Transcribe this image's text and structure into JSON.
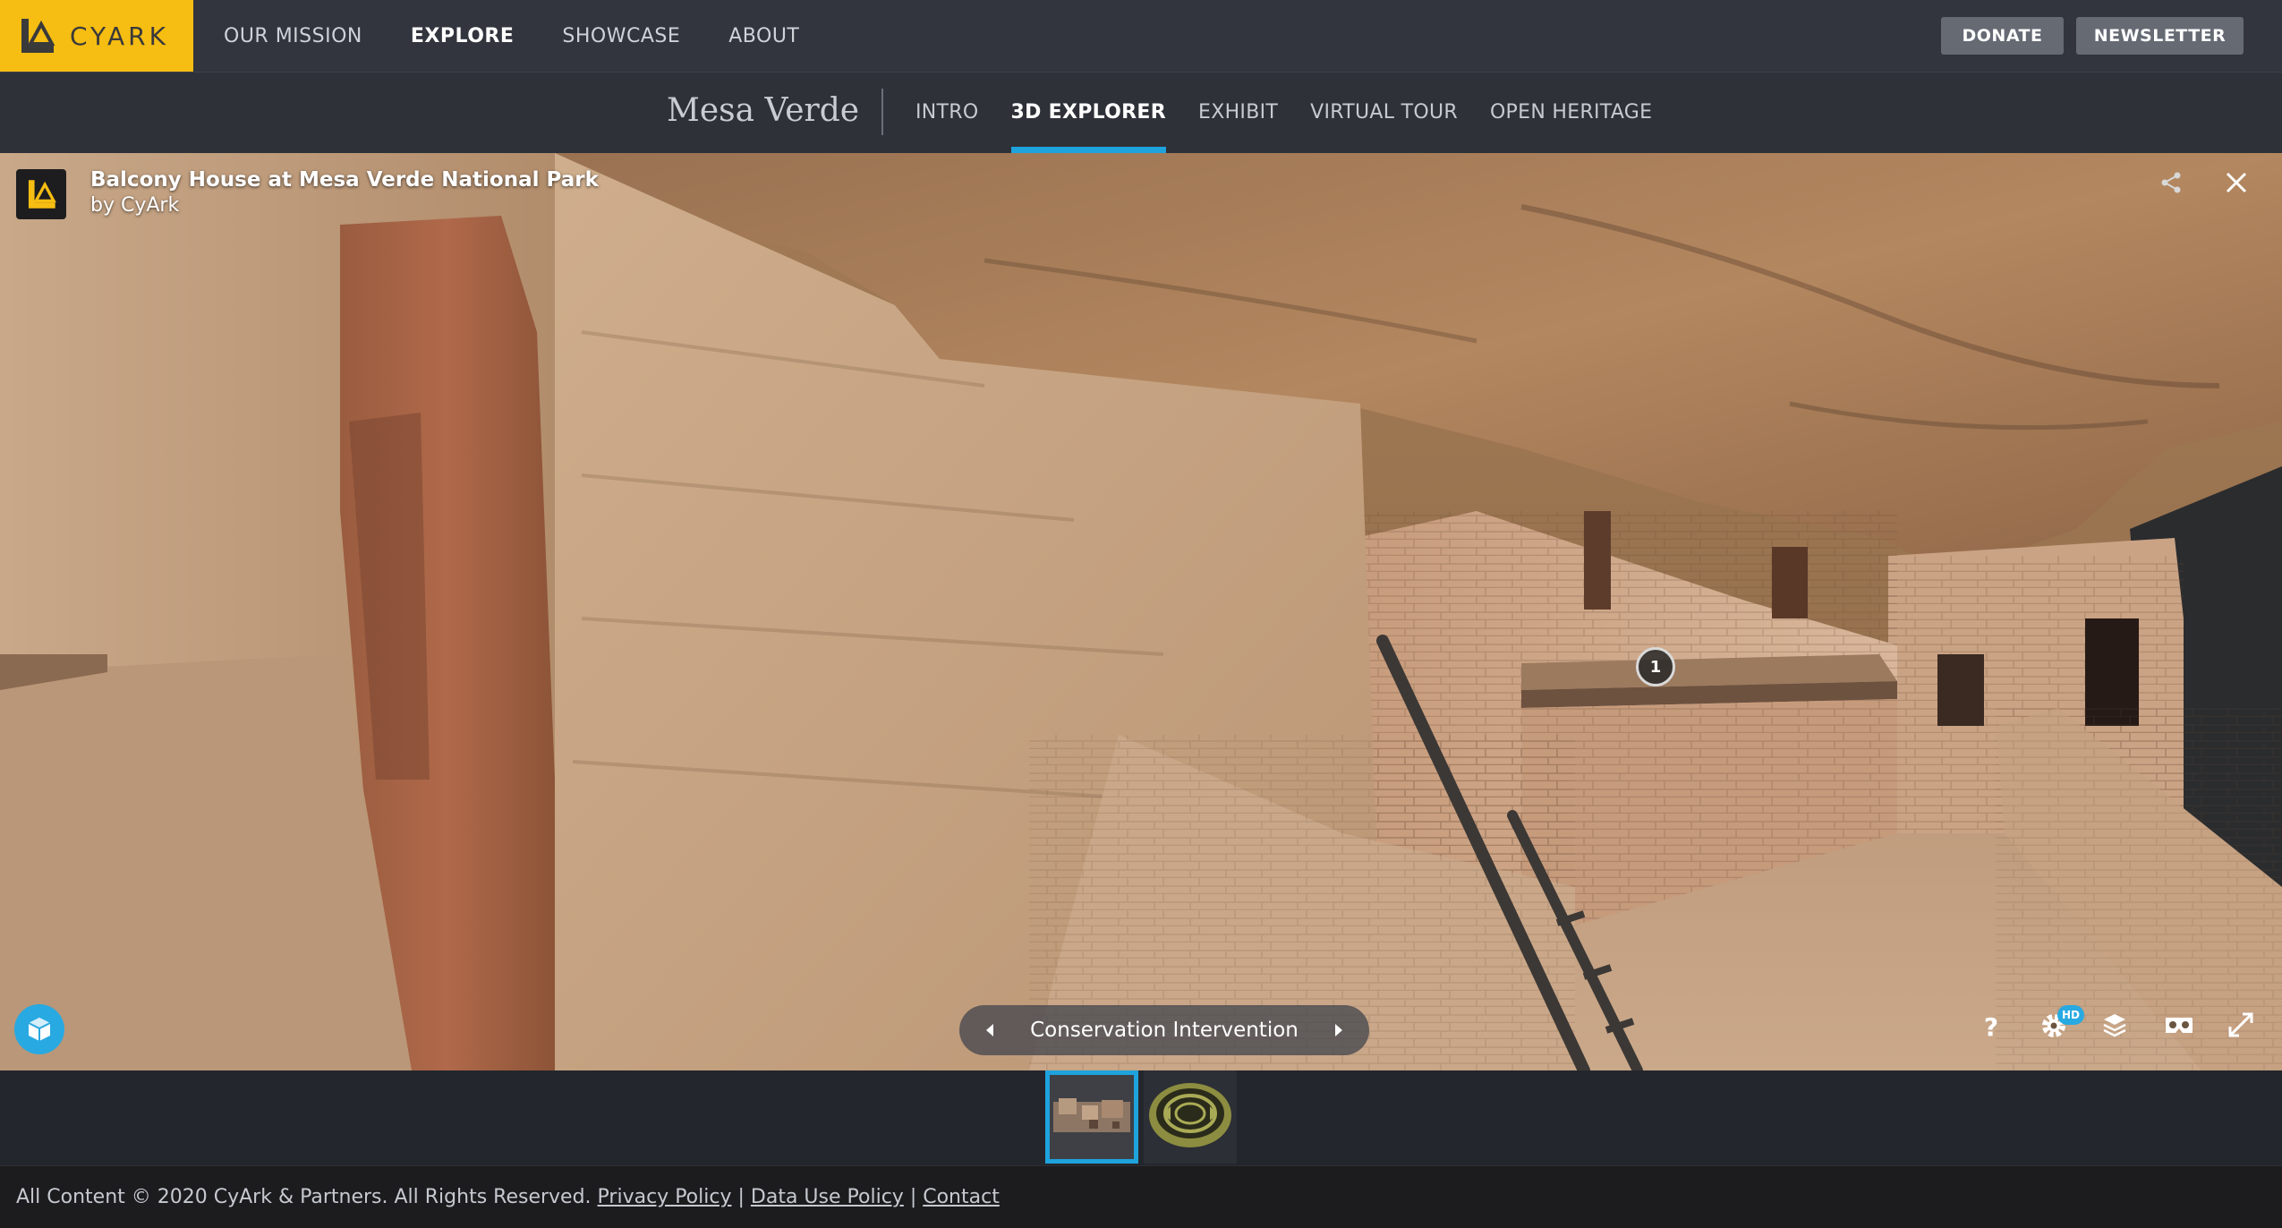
{
  "brand": {
    "name": "CYARK"
  },
  "main_nav": {
    "items": [
      {
        "label": "OUR MISSION"
      },
      {
        "label": "EXPLORE",
        "active": true
      },
      {
        "label": "SHOWCASE"
      },
      {
        "label": "ABOUT"
      }
    ]
  },
  "header_buttons": {
    "donate": "DONATE",
    "newsletter": "NEWSLETTER"
  },
  "sub_nav": {
    "site_title": "Mesa Verde",
    "items": [
      {
        "label": "INTRO"
      },
      {
        "label": "3D EXPLORER",
        "active": true
      },
      {
        "label": "EXHIBIT"
      },
      {
        "label": "VIRTUAL TOUR"
      },
      {
        "label": "OPEN HERITAGE"
      }
    ]
  },
  "viewer": {
    "model_title": "Balcony House at Mesa Verde National Park",
    "author": "by CyArk",
    "hotspot_number": "1",
    "tour_label": "Conservation Intervention",
    "hd_badge": "HD",
    "controls": [
      "help-icon",
      "settings-icon",
      "layers-icon",
      "vr-headset-icon",
      "fullscreen-icon"
    ]
  },
  "thumbnails": [
    {
      "name": "balcony-house-thumbnail",
      "selected": true
    },
    {
      "name": "pottery-bowl-thumbnail",
      "selected": false
    }
  ],
  "footer": {
    "copyright": "All Content © 2020 CyArk & Partners. All Rights Reserved.",
    "links": [
      "Privacy Policy",
      "Data Use Policy",
      "Contact"
    ],
    "separator": "|"
  },
  "colors": {
    "brand_yellow": "#f6bd12",
    "accent_blue": "#1ea3dd",
    "topbar_bg": "#32353d",
    "subbar_bg": "#2e3138"
  }
}
